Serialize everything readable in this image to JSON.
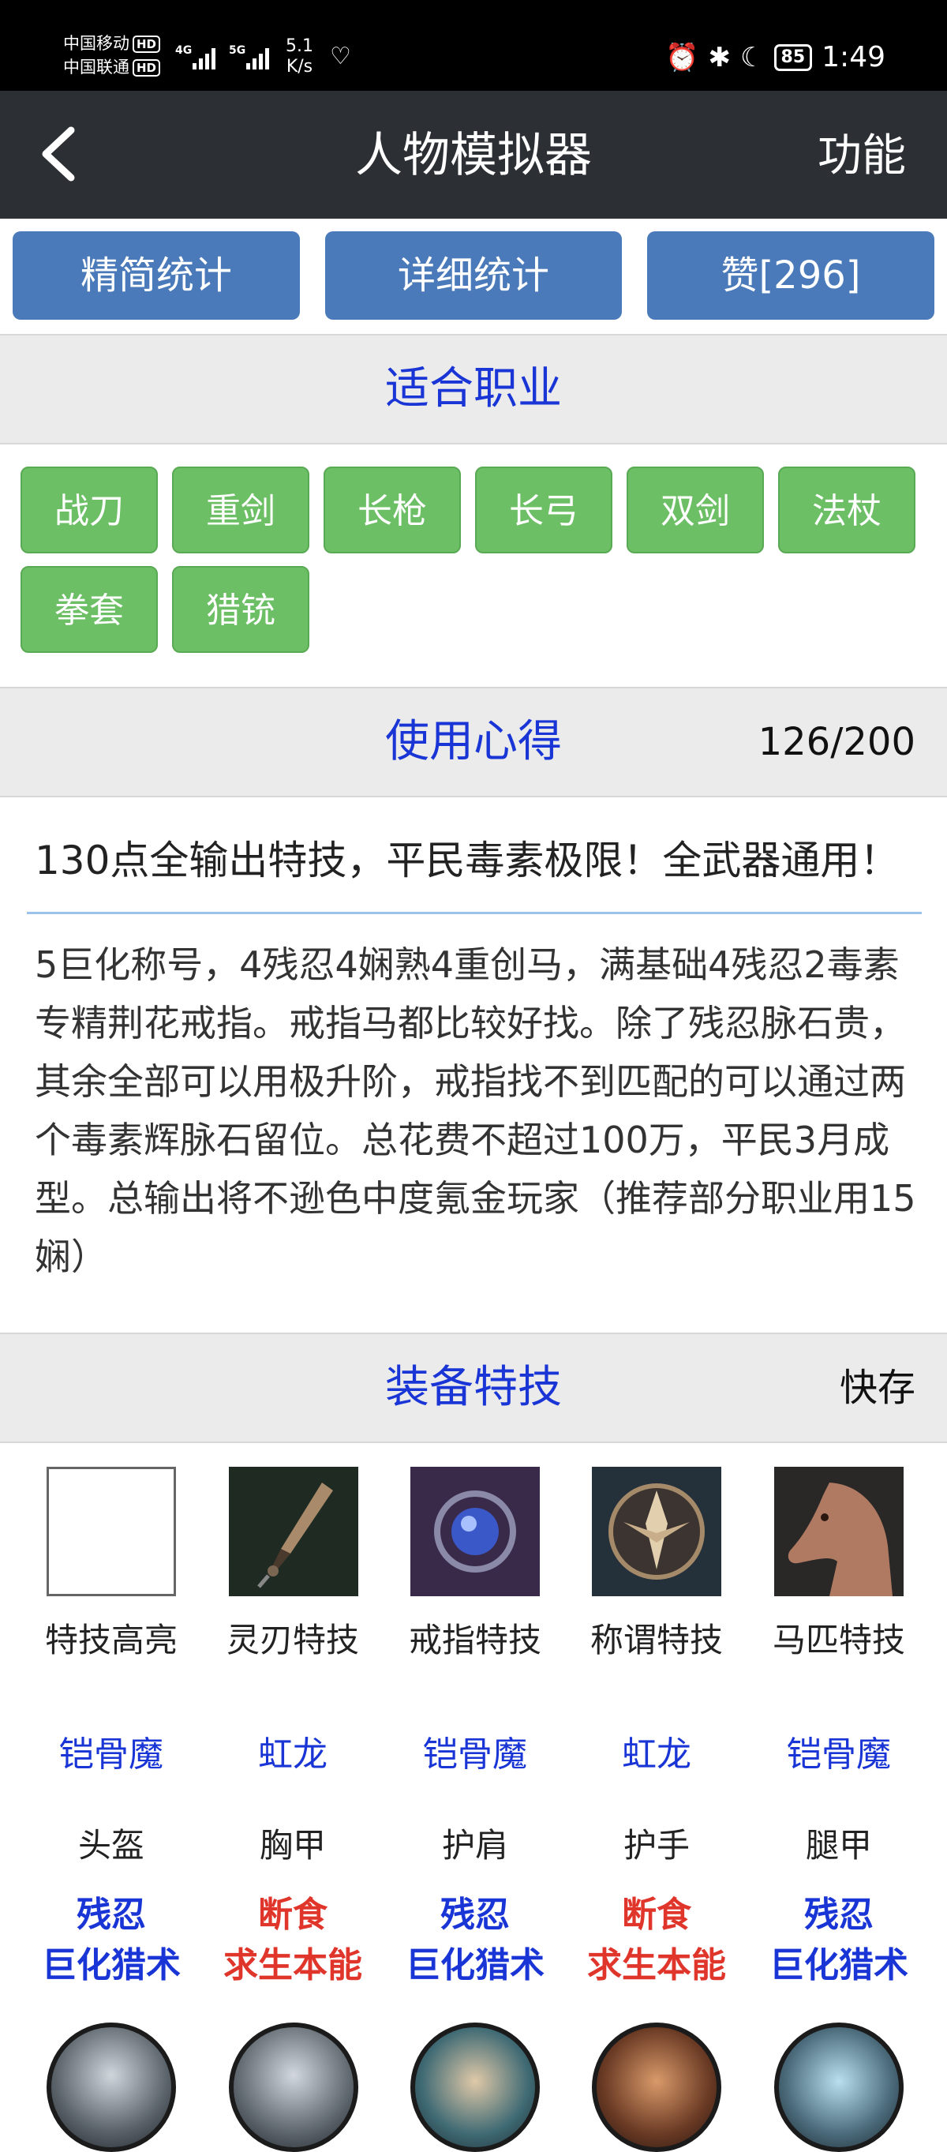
{
  "status": {
    "carrier1": "中国移动",
    "carrier2": "中国联通",
    "hd": "HD",
    "net1": "4G",
    "net2": "5G",
    "speed_value": "5.1",
    "speed_unit": "K/s",
    "battery": "85",
    "time": "1:49"
  },
  "header": {
    "title": "人物模拟器",
    "function_label": "功能"
  },
  "top_buttons": {
    "brief": "精简统计",
    "detail": "详细统计",
    "like": "赞[296]"
  },
  "jobs": {
    "title": "适合职业",
    "items": [
      "战刀",
      "重剑",
      "长枪",
      "长弓",
      "双剑",
      "法杖",
      "拳套",
      "猎铳"
    ]
  },
  "experience": {
    "title": "使用心得",
    "count": "126/200",
    "summary": "130点全输出特技，平民毒素极限！全武器通用！",
    "body": "5巨化称号，4残忍4娴熟4重创马，满基础4残忍2毒素专精荆花戒指。戒指马都比较好找。除了残忍脉石贵，其余全部可以用极升阶，戒指找不到匹配的可以通过两个毒素辉脉石留位。总花费不超过100万，平民3月成型。总输出将不逊色中度氪金玩家（推荐部分职业用15娴）"
  },
  "equipment": {
    "title": "装备特技",
    "quick_save": "快存",
    "icons": [
      "特技高亮",
      "灵刃特技",
      "戒指特技",
      "称谓特技",
      "马匹特技"
    ],
    "sets": [
      "铠骨魔",
      "虹龙",
      "铠骨魔",
      "虹龙",
      "铠骨魔"
    ],
    "slots": [
      "头盔",
      "胸甲",
      "护肩",
      "护手",
      "腿甲"
    ],
    "skills": [
      {
        "line1": "残忍",
        "line2": "巨化猎术",
        "color": "#1a35d6"
      },
      {
        "line1": "断食",
        "line2": "求生本能",
        "color": "#e0352b"
      },
      {
        "line1": "残忍",
        "line2": "巨化猎术",
        "color": "#1a35d6"
      },
      {
        "line1": "断食",
        "line2": "求生本能",
        "color": "#e0352b"
      },
      {
        "line1": "残忍",
        "line2": "巨化猎术",
        "color": "#1a35d6"
      }
    ]
  }
}
